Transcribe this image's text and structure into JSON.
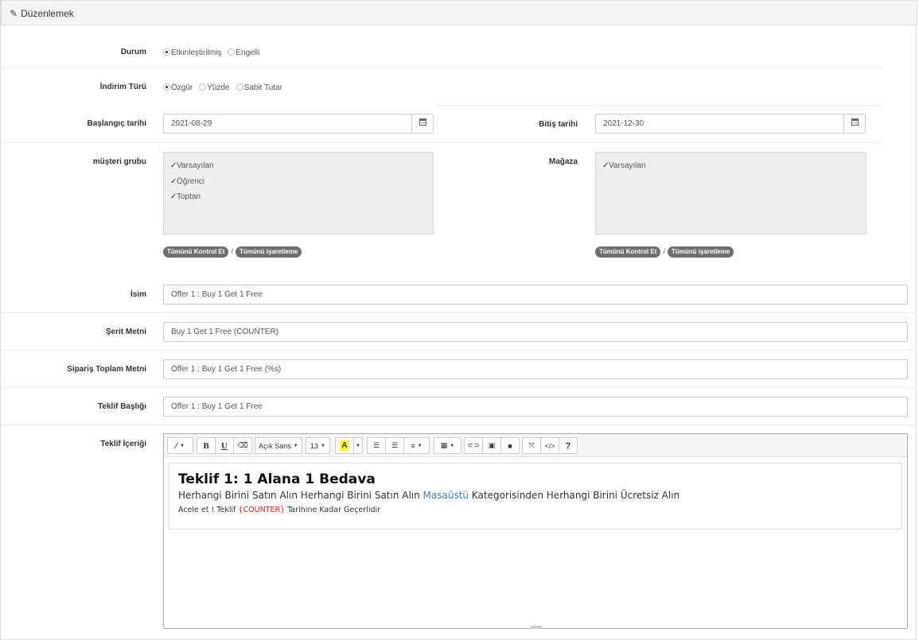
{
  "header": {
    "title": "Düzenlemek"
  },
  "status": {
    "label": "Durum",
    "options": [
      "Etkinleştirilmiş",
      "Engelli"
    ],
    "selected": 0
  },
  "discount_type": {
    "label": "İndirim Türü",
    "options": [
      "Özgür",
      "Yüzde",
      "Sabit Tutar"
    ],
    "selected": 0
  },
  "start_date": {
    "label": "Başlangıç tarihi",
    "value": "2021-08-29"
  },
  "end_date": {
    "label": "Bitiş tarihi",
    "value": "2021-12-30"
  },
  "customer_group": {
    "label": "müşteri grubu",
    "items": [
      "Varsayılan",
      "Öğrenci",
      "Toptan"
    ],
    "check_all": "Tümünü Kontrol Et",
    "uncheck_all": "Tümünü işaretleme"
  },
  "store": {
    "label": "Mağaza",
    "items": [
      "Varsayılan"
    ],
    "check_all": "Tümünü Kontrol Et",
    "uncheck_all": "Tümünü işaretleme"
  },
  "name": {
    "label": "İsim",
    "value": "Offer 1 : Buy 1 Get 1 Free"
  },
  "ribbon": {
    "label": "Şerit Metni",
    "value": "Buy 1 Get 1 Free (COUNTER)"
  },
  "order_total": {
    "label": "Sipariş Toplam Metni",
    "value": "Offer 1 : Buy 1 Get 1 Free (%s)"
  },
  "offer_title": {
    "label": "Teklif Başlığı",
    "value": "Offer 1 : Buy 1 Get 1 Free"
  },
  "offer_content": {
    "label": "Teklif İçeriği",
    "toolbar": {
      "font_name": "Açık Sans",
      "font_size": "13",
      "bold": "B",
      "underline": "U",
      "help": "?",
      "code": "</>"
    },
    "heading": "Teklif 1: 1 Alana 1 Bedava",
    "line1_a": "Herhangi Birini Satın Alın Herhangi Birini Satın Alın ",
    "line1_link": "Masaüstü",
    "line1_b": " Kategorisinden Herhangi Birini Ücretsiz Alın",
    "line2_a": "Acele et ! Teklif ",
    "line2_red": "{COUNTER}",
    "line2_b": " Tarihine Kadar Geçerlidir"
  },
  "colors": {
    "link": "#3b7fc4",
    "counter": "#e02020",
    "pill": "#6f6f6f"
  }
}
